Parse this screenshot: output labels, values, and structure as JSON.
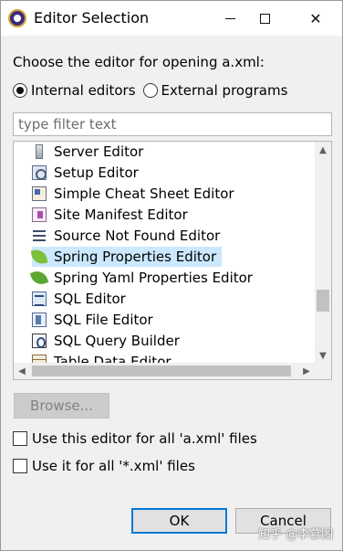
{
  "window": {
    "title": "Editor Selection",
    "close_glyph": "✕"
  },
  "prompt": "Choose the editor for opening a.xml:",
  "mode": {
    "internal_label": "Internal editors",
    "external_label": "External programs",
    "selected": "internal"
  },
  "filter": {
    "placeholder": "type filter text",
    "value": ""
  },
  "editors": [
    {
      "label": "Server Editor",
      "icon": "server-icon"
    },
    {
      "label": "Setup Editor",
      "icon": "setup-icon"
    },
    {
      "label": "Simple Cheat Sheet Editor",
      "icon": "cheat-sheet-icon"
    },
    {
      "label": "Site Manifest Editor",
      "icon": "site-manifest-icon"
    },
    {
      "label": "Source Not Found Editor",
      "icon": "source-lines-icon"
    },
    {
      "label": "Spring Properties Editor",
      "icon": "spring-leaf-icon",
      "selected": true
    },
    {
      "label": "Spring Yaml Properties Editor",
      "icon": "spring-leaf-icon"
    },
    {
      "label": "SQL Editor",
      "icon": "sql-icon"
    },
    {
      "label": "SQL File Editor",
      "icon": "sql-file-icon"
    },
    {
      "label": "SQL Query Builder",
      "icon": "sql-query-icon"
    },
    {
      "label": "Table Data Editor",
      "icon": "table-icon"
    }
  ],
  "scroll": {
    "up": "▲",
    "down": "▼",
    "left": "◀",
    "right": "▶"
  },
  "browse_label": "Browse...",
  "options": {
    "use_for_file": "Use this editor for all 'a.xml' files",
    "use_for_ext": "Use it for all '*.xml' files"
  },
  "buttons": {
    "ok": "OK",
    "cancel": "Cancel"
  },
  "watermark": "知乎 @李慕图",
  "colors": {
    "selection": "#cce8ff",
    "default_button_border": "#0078d7"
  }
}
